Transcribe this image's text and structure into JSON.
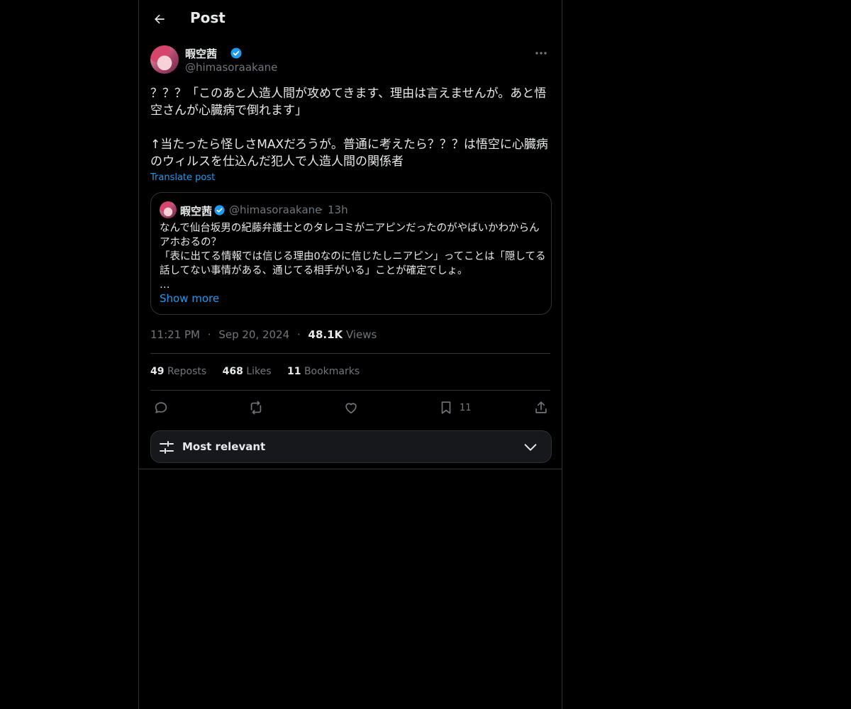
{
  "header": {
    "title": "Post"
  },
  "post": {
    "author": {
      "display_name": "暇空茜",
      "handle": "@himasoraakane"
    },
    "text": "？？？「このあと人造人間が攻めてきます、理由は言えませんが。あと悟空さんが心臓病で倒れます」\n\n↑当たったら怪しさMAXだろうが。普通に考えたら？？？は悟空に心臓病のウィルスを仕込んだ犯人で人造人間の関係者",
    "translate_label": "Translate post",
    "quote": {
      "display_name": "暇空茜",
      "handle": "@himasoraakane",
      "separator": "·",
      "time": "13h",
      "text": "なんで仙台坂男の紀藤弁護士とのタレコミがニアピンだったのがやばいかわからんアホおるの？\n「表に出てる情報では信じる理由0なのに信じたしニアピン」ってことは「隠してる話してない事情がある、通じてる相手がいる」ことが確定でしょ。\n…",
      "show_more": "Show more"
    },
    "meta": {
      "time": "11:21 PM",
      "sep": "·",
      "date": "Sep 20, 2024",
      "views_count": "48.1K",
      "views_label": "Views"
    },
    "stats": {
      "reposts_count": "49",
      "reposts_label": "Reposts",
      "likes_count": "468",
      "likes_label": "Likes",
      "bookmarks_count": "11",
      "bookmarks_label": "Bookmarks"
    },
    "actions": {
      "reply_icon": "reply-icon",
      "repost_icon": "repost-icon",
      "like_icon": "heart-icon",
      "bookmark_icon": "bookmark-icon",
      "bookmark_count": "11",
      "share_icon": "share-icon"
    }
  },
  "sort": {
    "label": "Most relevant"
  },
  "colors": {
    "background": "#000000",
    "accent": "#1d9bf0",
    "muted": "#71767b",
    "text": "#e7e9ea",
    "border": "#2f3336"
  }
}
